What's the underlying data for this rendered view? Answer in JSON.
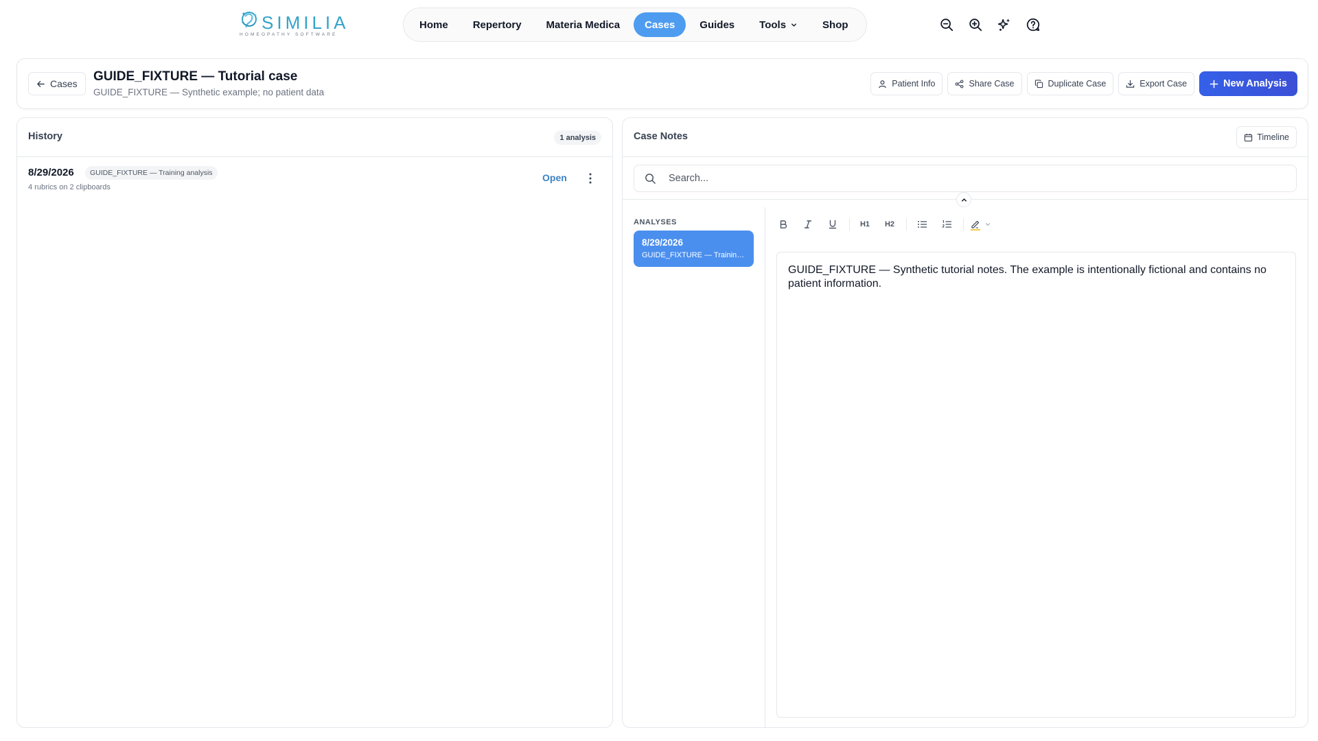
{
  "brand": {
    "name": "SIMILIA",
    "tagline": "HOMEOPATHY SOFTWARE",
    "color": "#33a3c9"
  },
  "nav": {
    "items": [
      {
        "label": "Home"
      },
      {
        "label": "Repertory"
      },
      {
        "label": "Materia Medica"
      },
      {
        "label": "Cases",
        "active": true
      },
      {
        "label": "Guides"
      },
      {
        "label": "Tools",
        "has_dropdown": true
      },
      {
        "label": "Shop"
      }
    ],
    "icons": [
      "zoom-out-icon",
      "zoom-in-icon",
      "sparkles-icon",
      "help-icon"
    ],
    "active_color": "#4e9cf0"
  },
  "case": {
    "back_label": "Cases",
    "title": "GUIDE_FIXTURE — Tutorial case",
    "subtitle": "GUIDE_FIXTURE — Synthetic example; no patient data",
    "actions": {
      "patient_info": "Patient Info",
      "share": "Share Case",
      "duplicate": "Duplicate Case",
      "export": "Export Case",
      "new_analysis": "New Analysis"
    },
    "primary_color": "#3357e0"
  },
  "history": {
    "title": "History",
    "count_label": "1 analysis",
    "rows": [
      {
        "date": "8/29/2026",
        "tag": "GUIDE_FIXTURE — Training analysis",
        "meta": "4 rubrics on 2 clipboards",
        "open_label": "Open"
      }
    ]
  },
  "notes": {
    "title": "Case Notes",
    "timeline_label": "Timeline",
    "search_placeholder": "Search...",
    "analyses_label": "ANALYSES",
    "analyses": [
      {
        "date": "8/29/2026",
        "name": "GUIDE_FIXTURE — Training analysis",
        "selected": true
      }
    ],
    "toolbar": {
      "h1": "H1",
      "h2": "H2"
    },
    "body": "GUIDE_FIXTURE — Synthetic tutorial notes. The example is intentionally fictional and contains no patient information."
  }
}
